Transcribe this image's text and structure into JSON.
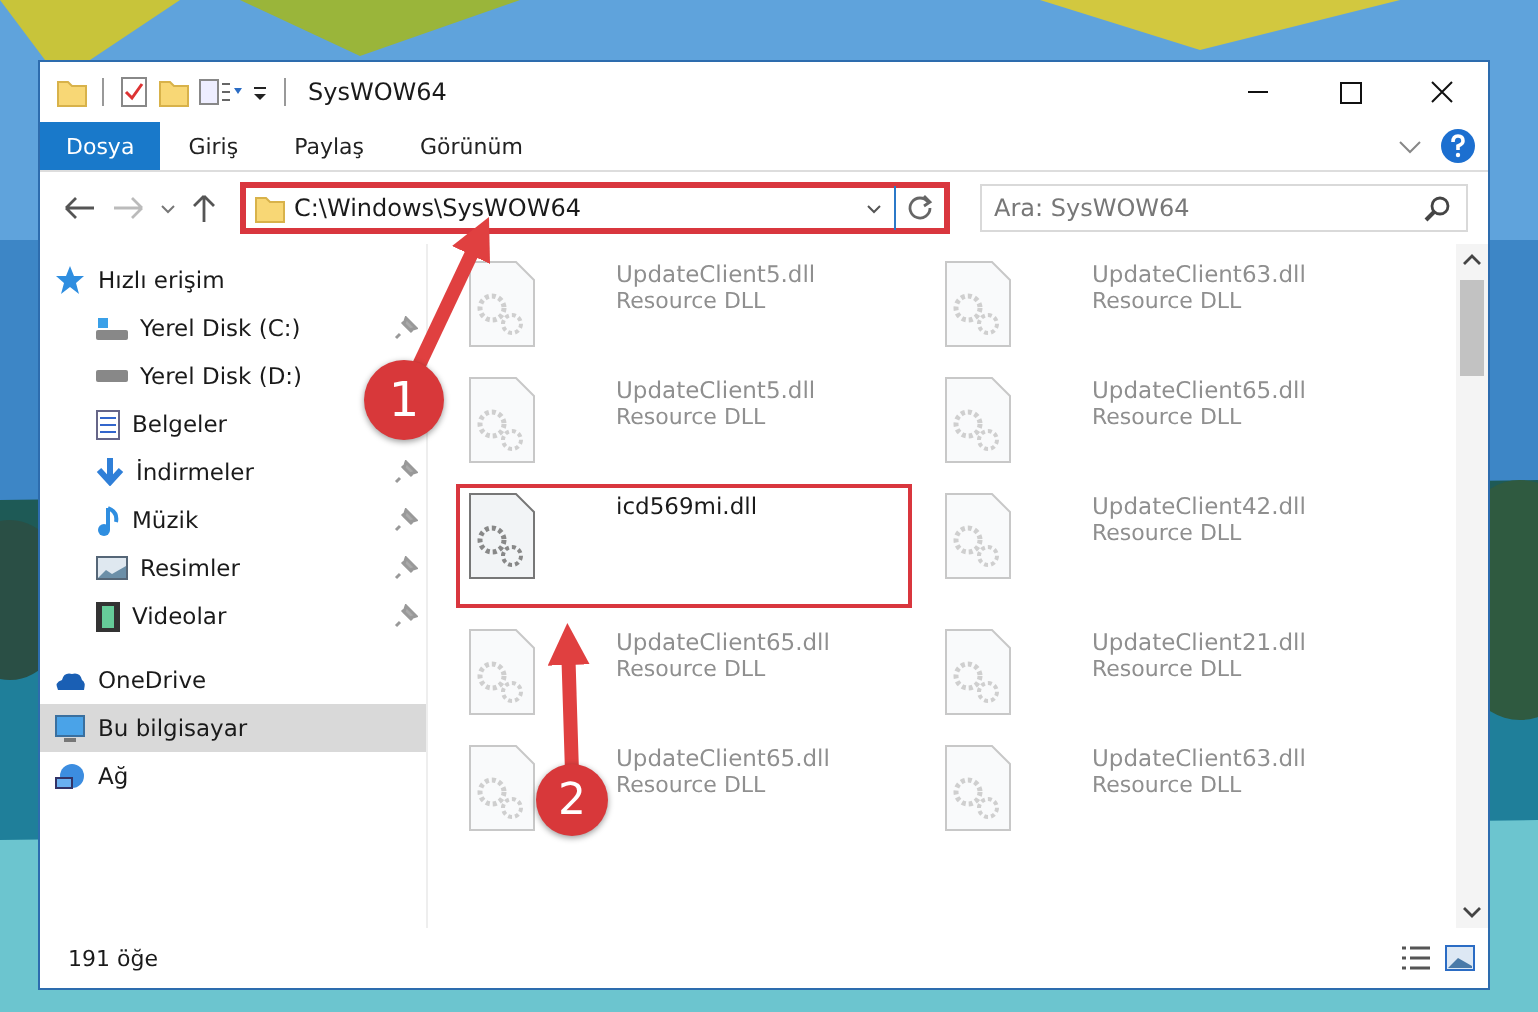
{
  "window": {
    "title": "SysWOW64"
  },
  "ribbon_tabs": [
    {
      "label": "Dosya",
      "selected": true
    },
    {
      "label": "Giriş",
      "selected": false
    },
    {
      "label": "Paylaş",
      "selected": false
    },
    {
      "label": "Görünüm",
      "selected": false
    }
  ],
  "address": {
    "value": "C:\\Windows\\SysWOW64",
    "highlighted": true
  },
  "search": {
    "placeholder": "Ara: SysWOW64"
  },
  "sidebar": {
    "items": [
      {
        "label": "Hızlı erişim",
        "selected": false,
        "children": [
          {
            "label": "Yerel Disk (C:)",
            "pinned": true
          },
          {
            "label": "Yerel Disk (D:)",
            "pinned": false
          },
          {
            "label": "Belgeler",
            "pinned": false
          },
          {
            "label": "İndirmeler",
            "pinned": true
          },
          {
            "label": "Müzik",
            "pinned": true
          },
          {
            "label": "Resimler",
            "pinned": true
          },
          {
            "label": "Videolar",
            "pinned": true
          }
        ]
      },
      {
        "label": "OneDrive",
        "selected": false
      },
      {
        "label": "Bu bilgisayar",
        "selected": true
      },
      {
        "label": "Ağ",
        "selected": false
      }
    ]
  },
  "files": [
    {
      "name": "UpdateClient5.dll",
      "type": "Resource DLL",
      "dimmed": true,
      "highlighted": false
    },
    {
      "name": "UpdateClient63.dll",
      "type": "Resource DLL",
      "dimmed": true,
      "highlighted": false
    },
    {
      "name": "UpdateClient5.dll",
      "type": "Resource DLL",
      "dimmed": true,
      "highlighted": false
    },
    {
      "name": "UpdateClient65.dll",
      "type": "Resource DLL",
      "dimmed": true,
      "highlighted": false
    },
    {
      "name": "icd569mi.dll",
      "dimmed": false,
      "highlighted": true
    },
    {
      "name": "UpdateClient42.dll",
      "type": "Resource DLL",
      "dimmed": true,
      "highlighted": false
    },
    {
      "name": "UpdateClient65.dll",
      "type": "Resource DLL",
      "dimmed": true,
      "highlighted": false
    },
    {
      "name": "UpdateClient21.dll",
      "type": "Resource DLL",
      "dimmed": true,
      "highlighted": false
    },
    {
      "name": "UpdateClient65.dll",
      "type": "Resource DLL",
      "dimmed": true,
      "highlighted": false
    },
    {
      "name": "UpdateClient63.dll",
      "type": "Resource DLL",
      "dimmed": true,
      "highlighted": false
    }
  ],
  "status_bar": {
    "count": "191 öğe"
  },
  "annotations": [
    {
      "label": "1"
    },
    {
      "label": "2"
    }
  ]
}
